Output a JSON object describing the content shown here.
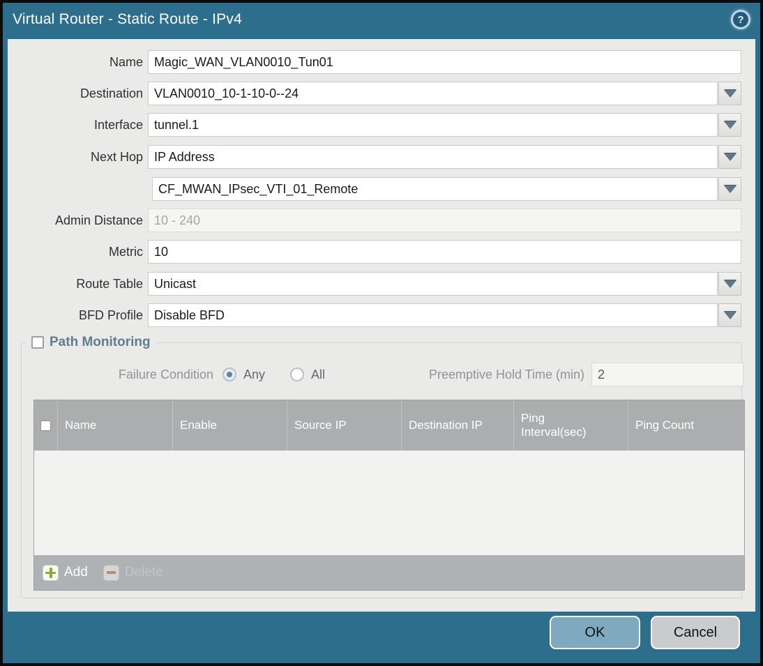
{
  "window": {
    "title": "Virtual Router - Static Route - IPv4",
    "help_glyph": "?"
  },
  "fields": {
    "name": {
      "label": "Name",
      "value": "Magic_WAN_VLAN0010_Tun01"
    },
    "destination": {
      "label": "Destination",
      "value": "VLAN0010_10-1-10-0--24"
    },
    "interface": {
      "label": "Interface",
      "value": "tunnel.1"
    },
    "next_hop": {
      "label": "Next Hop",
      "value": "IP Address"
    },
    "next_hop_address": {
      "value": "CF_MWAN_IPsec_VTI_01_Remote"
    },
    "admin_distance": {
      "label": "Admin Distance",
      "placeholder": "10 - 240",
      "value": ""
    },
    "metric": {
      "label": "Metric",
      "value": "10"
    },
    "route_table": {
      "label": "Route Table",
      "value": "Unicast"
    },
    "bfd_profile": {
      "label": "BFD Profile",
      "value": "Disable BFD"
    }
  },
  "path_monitoring": {
    "title": "Path Monitoring",
    "checkbox_checked": false,
    "failure_condition": {
      "label": "Failure Condition",
      "options": [
        {
          "label": "Any",
          "selected": true
        },
        {
          "label": "All",
          "selected": false
        }
      ]
    },
    "preemptive_hold_time": {
      "label": "Preemptive Hold Time (min)",
      "value": "2"
    },
    "table": {
      "columns": [
        "Name",
        "Enable",
        "Source IP",
        "Destination IP",
        "Ping Interval(sec)",
        "Ping Count"
      ],
      "rows": []
    },
    "toolbar": {
      "add_label": "Add",
      "delete_label": "Delete"
    }
  },
  "footer": {
    "ok_label": "OK",
    "cancel_label": "Cancel"
  },
  "colors": {
    "titlebar_teal": "#2d6e8d",
    "content_bg": "#eaeae8",
    "table_header_bg": "#abadaf",
    "toolbar_bg": "#afb2b4",
    "ok_button_bg": "#7fa9be",
    "cancel_button_bg": "#c9cbcd",
    "pm_title_color": "#5e7e90",
    "add_icon_green": "#8aa83e",
    "delete_icon_red": "#b06a5a",
    "radio_selected_dot": "#5c87a0"
  }
}
